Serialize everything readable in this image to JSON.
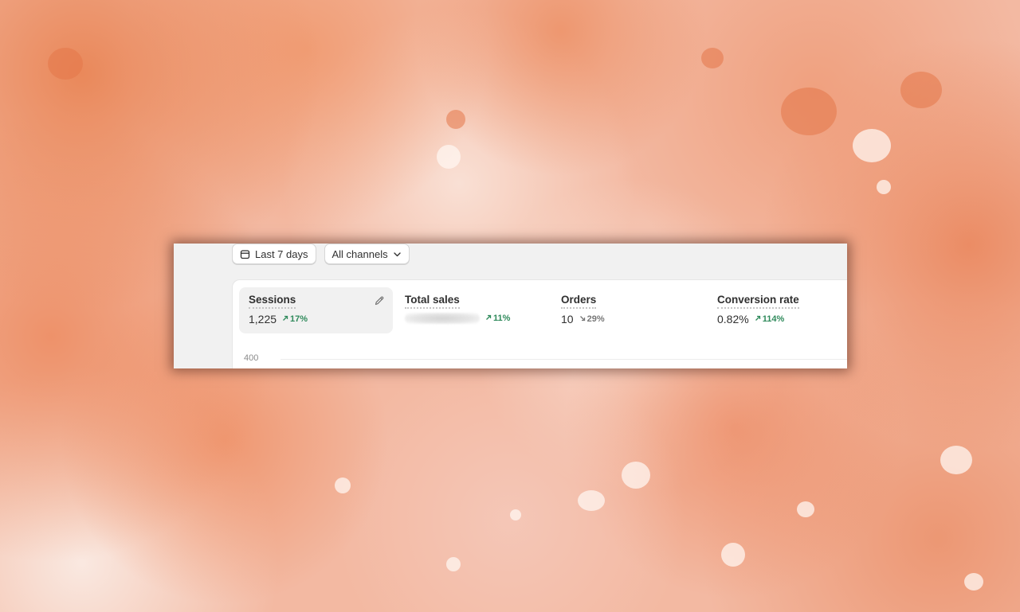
{
  "toolbar": {
    "date_range_label": "Last 7 days",
    "channel_filter_label": "All channels"
  },
  "metrics": [
    {
      "label": "Sessions",
      "value": "1,225",
      "change": "17%",
      "trend": "up"
    },
    {
      "label": "Total sales",
      "value": "",
      "change": "11%",
      "trend": "up"
    },
    {
      "label": "Orders",
      "value": "10",
      "change": "29%",
      "trend": "down"
    },
    {
      "label": "Conversion rate",
      "value": "0.82%",
      "change": "114%",
      "trend": "up"
    }
  ],
  "chart": {
    "y_tick_top": "400"
  },
  "colors": {
    "positive": "#2f8a5b",
    "negative": "#777777",
    "text": "#303030"
  },
  "icons": {
    "calendar": "calendar-icon",
    "chevron": "chevron-down-icon",
    "edit": "pencil-icon",
    "trend_up": "arrow-up-right-icon",
    "trend_down": "arrow-down-right-icon"
  }
}
